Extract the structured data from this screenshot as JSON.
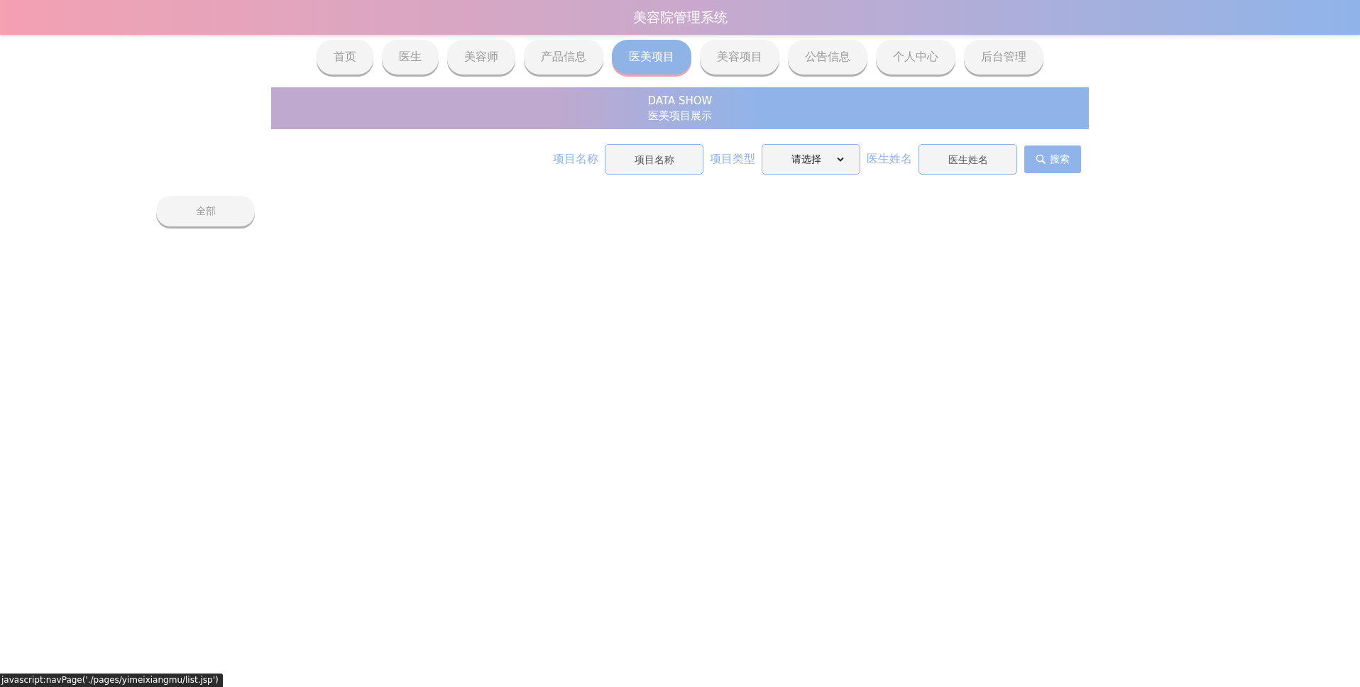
{
  "header": {
    "title": "美容院管理系统"
  },
  "nav": [
    {
      "label": "首页",
      "selected": false
    },
    {
      "label": "医生",
      "selected": false
    },
    {
      "label": "美容师",
      "selected": false
    },
    {
      "label": "产品信息",
      "selected": false
    },
    {
      "label": "医美项目",
      "selected": true
    },
    {
      "label": "美容项目",
      "selected": false
    },
    {
      "label": "公告信息",
      "selected": false
    },
    {
      "label": "个人中心",
      "selected": false
    },
    {
      "label": "后台管理",
      "selected": false
    }
  ],
  "banner": {
    "title": "DATA SHOW",
    "subtitle": "医美项目展示"
  },
  "search": {
    "fields": [
      {
        "kind": "input",
        "label": "项目名称",
        "placeholder": "项目名称"
      },
      {
        "kind": "select",
        "label": "项目类型",
        "value": "请选择"
      },
      {
        "kind": "input",
        "label": "医生姓名",
        "placeholder": "医生姓名"
      }
    ],
    "button": "搜索"
  },
  "categories": [
    {
      "label": "全部"
    }
  ],
  "status_bar": {
    "text": "javascript:navPage('./pages/yimeixiangmu/list.jsp')"
  }
}
